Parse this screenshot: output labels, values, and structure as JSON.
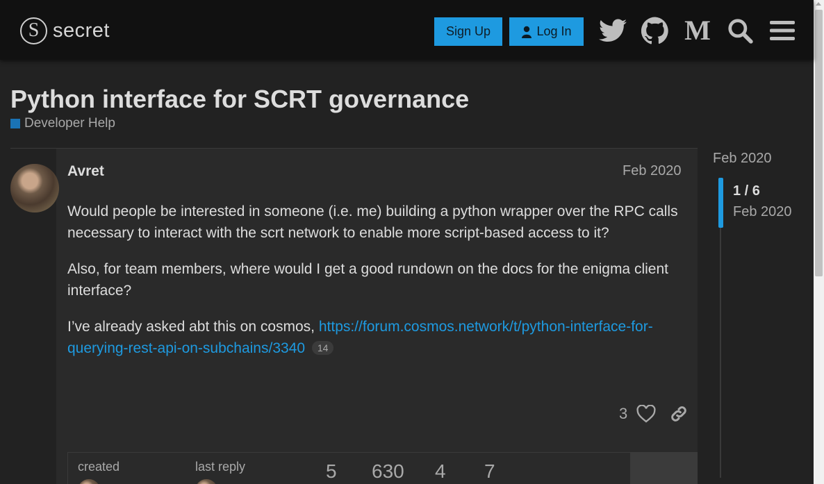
{
  "header": {
    "logo_glyph": "S",
    "logo_text": "secret",
    "signup_label": "Sign Up",
    "login_label": "Log In",
    "icons": [
      "twitter-icon",
      "github-icon",
      "medium-icon",
      "search-icon",
      "menu-icon"
    ],
    "medium_glyph": "M"
  },
  "topic": {
    "title": "Python interface for SCRT governance",
    "category": "Developer Help",
    "category_color": "#1a73b5"
  },
  "post": {
    "username": "Avret",
    "date": "Feb 2020",
    "paragraphs": {
      "p1": "Would people be interested in someone (i.e. me) building a python wrapper over the RPC calls necessary to interact with the scrt network to enable more script-based access to it?",
      "p2": "Also, for team members, where would I get a good rundown on the docs for the enigma client interface?",
      "p3_prefix": "I’ve already asked abt this on cosmos, ",
      "p3_link": "https://forum.cosmos.network/t/python-interface-for-querying-rest-api-on-subchains/3340",
      "p3_link_clicks": "14"
    },
    "like_count": "3"
  },
  "topic_map": {
    "created_label": "created",
    "last_reply_label": "last reply",
    "stats": [
      "5",
      "630",
      "4",
      "7"
    ]
  },
  "timeline": {
    "top_date": "Feb 2020",
    "position": "1 / 6",
    "current_date": "Feb 2020"
  },
  "colors": {
    "accent": "#1e9ae0",
    "background": "#222222",
    "header": "#111111"
  }
}
